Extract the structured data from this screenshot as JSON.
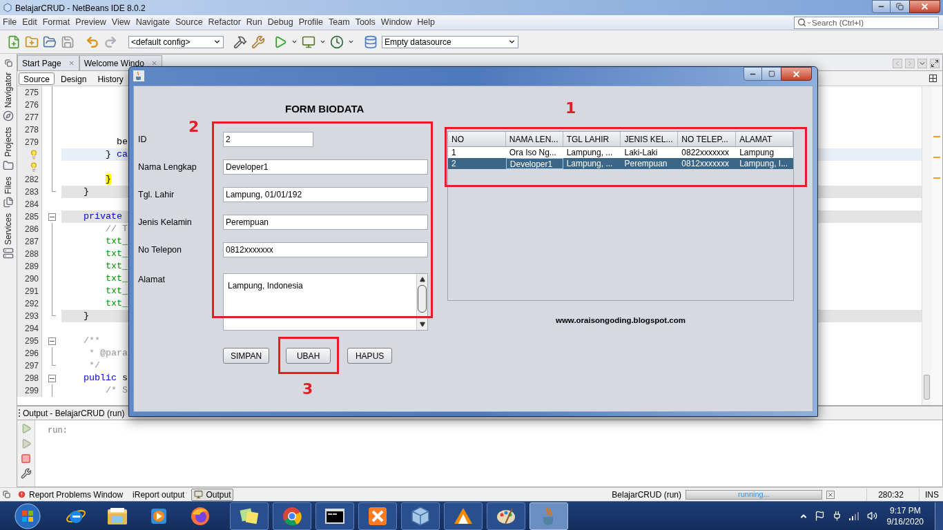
{
  "window": {
    "title": "BelajarCRUD - NetBeans IDE 8.0.2"
  },
  "menu": [
    "File",
    "Edit",
    "Format",
    "Preview",
    "View",
    "Navigate",
    "Source",
    "Refactor",
    "Run",
    "Debug",
    "Profile",
    "Team",
    "Tools",
    "Window",
    "Help"
  ],
  "search": {
    "placeholder": "Search (Ctrl+I)"
  },
  "toolbar": {
    "config": "<default config>",
    "datasource": "Empty datasource"
  },
  "side_tabs": [
    "Navigator",
    "Projects",
    "Files",
    "Services"
  ],
  "editor_tabs": [
    {
      "label": "Start Page",
      "selected": false
    },
    {
      "label": "Welcome Windo",
      "selected": false
    }
  ],
  "view_tabs": [
    {
      "label": "Source",
      "selected": true
    },
    {
      "label": "Design",
      "selected": false
    },
    {
      "label": "History",
      "selected": false
    }
  ],
  "code_lines": [
    {
      "kind": "number",
      "number": "275",
      "shaded": false,
      "current": false,
      "fold_start": false,
      "fold_end": false,
      "in_fold": true
    },
    {
      "kind": "number",
      "number": "276",
      "shaded": false,
      "current": false,
      "fold_start": false,
      "fold_end": false,
      "in_fold": true
    },
    {
      "kind": "number",
      "number": "277",
      "shaded": false,
      "current": false,
      "fold_start": false,
      "fold_end": false,
      "in_fold": true
    },
    {
      "kind": "number",
      "number": "278",
      "shaded": false,
      "current": false,
      "fold_start": false,
      "fold_end": false,
      "in_fold": true
    },
    {
      "kind": "number",
      "number": "279",
      "shaded": false,
      "current": false,
      "fold_start": false,
      "fold_end": false,
      "in_fold": true,
      "tokens": [
        {
          "text": "          be",
          "kind": "plain"
        }
      ]
    },
    {
      "kind": "warning",
      "shaded": false,
      "current": true,
      "fold_start": false,
      "fold_end": false,
      "in_fold": true,
      "tokens": [
        {
          "text": "        } ",
          "kind": "plain"
        },
        {
          "text": "ca",
          "kind": "keyword"
        }
      ]
    },
    {
      "kind": "warning",
      "shaded": false,
      "current": false,
      "fold_start": false,
      "fold_end": false,
      "in_fold": true
    },
    {
      "kind": "number",
      "number": "282",
      "shaded": false,
      "current": false,
      "fold_start": false,
      "fold_end": false,
      "in_fold": true,
      "tokens": [
        {
          "text": "        }",
          "kind": "brace"
        }
      ]
    },
    {
      "kind": "number",
      "number": "283",
      "shaded": true,
      "current": false,
      "fold_start": false,
      "fold_end": true,
      "in_fold": false,
      "tokens": [
        {
          "text": "    }",
          "kind": "plain"
        }
      ]
    },
    {
      "kind": "number",
      "number": "284",
      "shaded": false,
      "current": false,
      "fold_start": false,
      "fold_end": false,
      "in_fold": false
    },
    {
      "kind": "number",
      "number": "285",
      "shaded": true,
      "current": false,
      "fold_start": true,
      "fold_end": false,
      "in_fold": false,
      "tokens": [
        {
          "text": "    private",
          "kind": "keyword"
        }
      ]
    },
    {
      "kind": "number",
      "number": "286",
      "shaded": false,
      "current": false,
      "fold_start": false,
      "fold_end": false,
      "in_fold": true,
      "tokens": [
        {
          "text": "        // T",
          "kind": "comment"
        }
      ]
    },
    {
      "kind": "number",
      "number": "287",
      "shaded": false,
      "current": false,
      "fold_start": false,
      "fold_end": false,
      "in_fold": true,
      "tokens": [
        {
          "text": "        txt_",
          "kind": "field"
        }
      ]
    },
    {
      "kind": "number",
      "number": "288",
      "shaded": false,
      "current": false,
      "fold_start": false,
      "fold_end": false,
      "in_fold": true,
      "tokens": [
        {
          "text": "        txt_",
          "kind": "field"
        }
      ]
    },
    {
      "kind": "number",
      "number": "289",
      "shaded": false,
      "current": false,
      "fold_start": false,
      "fold_end": false,
      "in_fold": true,
      "tokens": [
        {
          "text": "        txt_",
          "kind": "field"
        }
      ]
    },
    {
      "kind": "number",
      "number": "290",
      "shaded": false,
      "current": false,
      "fold_start": false,
      "fold_end": false,
      "in_fold": true,
      "tokens": [
        {
          "text": "        txt_",
          "kind": "field"
        }
      ]
    },
    {
      "kind": "number",
      "number": "291",
      "shaded": false,
      "current": false,
      "fold_start": false,
      "fold_end": false,
      "in_fold": true,
      "tokens": [
        {
          "text": "        txt_",
          "kind": "field"
        }
      ]
    },
    {
      "kind": "number",
      "number": "292",
      "shaded": false,
      "current": false,
      "fold_start": false,
      "fold_end": false,
      "in_fold": true,
      "tokens": [
        {
          "text": "        txt_",
          "kind": "field"
        }
      ]
    },
    {
      "kind": "number",
      "number": "293",
      "shaded": true,
      "current": false,
      "fold_start": false,
      "fold_end": true,
      "in_fold": false,
      "tokens": [
        {
          "text": "    }",
          "kind": "plain"
        }
      ]
    },
    {
      "kind": "number",
      "number": "294",
      "shaded": false,
      "current": false,
      "fold_start": false,
      "fold_end": false,
      "in_fold": false
    },
    {
      "kind": "number",
      "number": "295",
      "shaded": false,
      "current": false,
      "fold_start": true,
      "fold_end": false,
      "in_fold": false,
      "tokens": [
        {
          "text": "    /**",
          "kind": "comment"
        }
      ]
    },
    {
      "kind": "number",
      "number": "296",
      "shaded": false,
      "current": false,
      "fold_start": false,
      "fold_end": false,
      "in_fold": true,
      "tokens": [
        {
          "text": "     * @para",
          "kind": "comment"
        }
      ]
    },
    {
      "kind": "number",
      "number": "297",
      "shaded": false,
      "current": false,
      "fold_start": false,
      "fold_end": true,
      "in_fold": false,
      "tokens": [
        {
          "text": "     */",
          "kind": "comment"
        }
      ]
    },
    {
      "kind": "number",
      "number": "298",
      "shaded": false,
      "current": false,
      "fold_start": true,
      "fold_end": false,
      "in_fold": false,
      "tokens": [
        {
          "text": "    public",
          "kind": "keyword"
        },
        {
          "text": " s",
          "kind": "plain"
        }
      ]
    },
    {
      "kind": "number",
      "number": "299",
      "shaded": false,
      "current": false,
      "fold_start": false,
      "fold_end": false,
      "in_fold": true,
      "tokens": [
        {
          "text": "        /* S",
          "kind": "comment"
        }
      ]
    }
  ],
  "output": {
    "title": "Output - BelajarCRUD (run)",
    "text": "run:"
  },
  "bottom_tabs": [
    {
      "label": "Report Problems Window",
      "selected": false,
      "kind": "problems"
    },
    {
      "label": "iReport output",
      "selected": false,
      "kind": "plain"
    },
    {
      "label": "Output",
      "selected": true,
      "kind": "output"
    }
  ],
  "status_bar": {
    "task": "BelajarCRUD (run)",
    "progress": "running...",
    "level": 1,
    "position": "280:32",
    "mode": "INS"
  },
  "dialog": {
    "title": "FORM BIODATA",
    "fields": [
      {
        "label": "ID",
        "value": "2",
        "kind": "short"
      },
      {
        "label": "Nama Lengkap",
        "value": "Developer1",
        "kind": "text"
      },
      {
        "label": "Tgl. Lahir",
        "value": "Lampung, 01/01/192",
        "kind": "text"
      },
      {
        "label": "Jenis Kelamin",
        "value": "Perempuan",
        "kind": "text"
      },
      {
        "label": "No Telepon",
        "value": "0812xxxxxxx",
        "kind": "text"
      },
      {
        "label": "Alamat",
        "value": "Lampung, Indonesia",
        "kind": "area"
      }
    ],
    "buttons": [
      "SIMPAN",
      "UBAH",
      "HAPUS"
    ],
    "table": {
      "columns": [
        "NO",
        "NAMA LEN...",
        "TGL LAHIR",
        "JENIS KEL...",
        "NO TELEP...",
        "ALAMAT"
      ],
      "rows": [
        {
          "selected": false,
          "cells": [
            "1",
            "Ora Iso Ng...",
            "Lampung, ...",
            "Laki-Laki",
            "0822xxxxxxx",
            "Lampung"
          ]
        },
        {
          "selected": true,
          "cells": [
            "2",
            "Developer1",
            "Lampung, ...",
            "Perempuan",
            "0812xxxxxxx",
            "Lampung, I..."
          ]
        }
      ]
    },
    "link": "www.oraisongoding.blogspot.com",
    "annotations": [
      "1",
      "2",
      "3"
    ]
  },
  "clock": {
    "time": "9:17 PM",
    "date": "9/16/2020"
  }
}
